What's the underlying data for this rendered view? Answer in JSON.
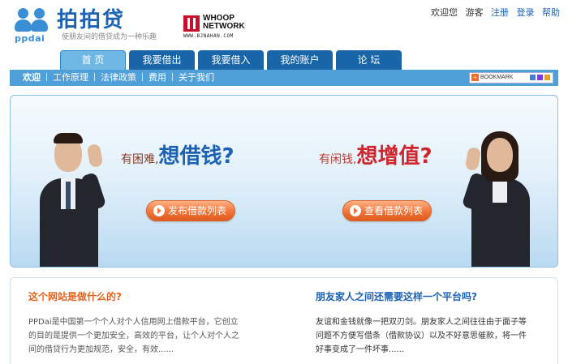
{
  "header": {
    "logo_cn": "拍拍贷",
    "logo_latin": "ppdai",
    "slogan": "使朋友间的借贷成为一种乐趣",
    "partner_name": "WHOOP NETWORK",
    "partner_url": "WWW.BJNAHAN.COM",
    "toplinks": {
      "welcome": "欢迎您",
      "guest": "游客",
      "register": "注册",
      "login": "登录",
      "help": "帮助"
    }
  },
  "nav": {
    "tabs": [
      "首 页",
      "我要借出",
      "我要借入",
      "我的账户",
      "论 坛"
    ],
    "active_tab": 0,
    "subnav": [
      "欢迎",
      "工作原理",
      "法律政策",
      "费用",
      "关于我们"
    ],
    "bookmark_label": "BOOKMARK"
  },
  "banner": {
    "left_small": "有困难,",
    "left_big": "想借钱?",
    "right_small": "有闲钱,",
    "right_big": "想增值?",
    "left_button": "发布借款列表",
    "right_button": "查看借款列表"
  },
  "info": {
    "left_title": "这个网站是做什么的?",
    "left_text": [
      "PPDai是中国第一个个人对个人信用网上借款平台，它创立",
      "的目的是提供一个更加安全，高效的平台，让个人对个人之",
      "间的借贷行为更加规范，安全，有效......"
    ],
    "right_title": "朋友家人之间还需要这样一个平台吗?",
    "right_text": [
      "友谊和金钱就像一把双刃剑。朋友家人之间往往由于面子等",
      "问题不方便写借条（借款协议）以及不好意思催款，将一件",
      "好事变成了一件坏事......"
    ]
  },
  "colors": {
    "brand_blue": "#1c62b4",
    "nav_blue": "#1866a8",
    "subnav_blue": "#4f9fd8",
    "accent_orange": "#f07438",
    "accent_red": "#d0252d"
  }
}
